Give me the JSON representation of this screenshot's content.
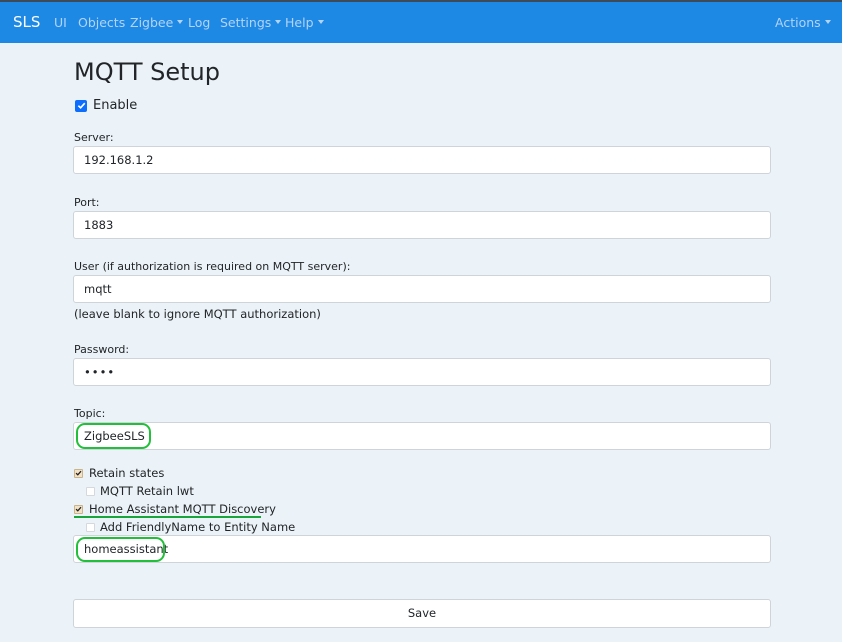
{
  "navbar": {
    "brand": "SLS",
    "items": [
      {
        "label": "UI",
        "dropdown": false
      },
      {
        "label": "Objects",
        "dropdown": false
      },
      {
        "label": "Zigbee",
        "dropdown": true
      },
      {
        "label": "Log",
        "dropdown": false
      },
      {
        "label": "Settings",
        "dropdown": true
      },
      {
        "label": "Help",
        "dropdown": true
      }
    ],
    "actions": {
      "label": "Actions",
      "dropdown": true
    },
    "color": "#1e88e5"
  },
  "page": {
    "title": "MQTT Setup",
    "enable": {
      "label": "Enable",
      "checked": true
    }
  },
  "form": {
    "server": {
      "label": "Server:",
      "value": "192.168.1.2"
    },
    "port": {
      "label": "Port:",
      "value": "1883"
    },
    "user": {
      "label": "User (if authorization is required on MQTT server):",
      "value": "mqtt",
      "help": "(leave blank to ignore MQTT authorization)"
    },
    "password": {
      "label": "Password:",
      "value": "••••"
    },
    "topic": {
      "label": "Topic:",
      "value": "ZigbeeSLS"
    },
    "retain_states": {
      "label": "Retain states",
      "checked": true
    },
    "retain_lwt": {
      "label": "MQTT Retain lwt",
      "checked": false
    },
    "ha_discovery": {
      "label": "Home Assistant MQTT Discovery",
      "checked": true
    },
    "friendly_name": {
      "label": "Add FriendlyName to Entity Name",
      "checked": false
    },
    "discovery_prefix": {
      "value": "homeassistant"
    },
    "save_label": "Save"
  },
  "annotations": {
    "highlight_color": "#22c03a"
  }
}
